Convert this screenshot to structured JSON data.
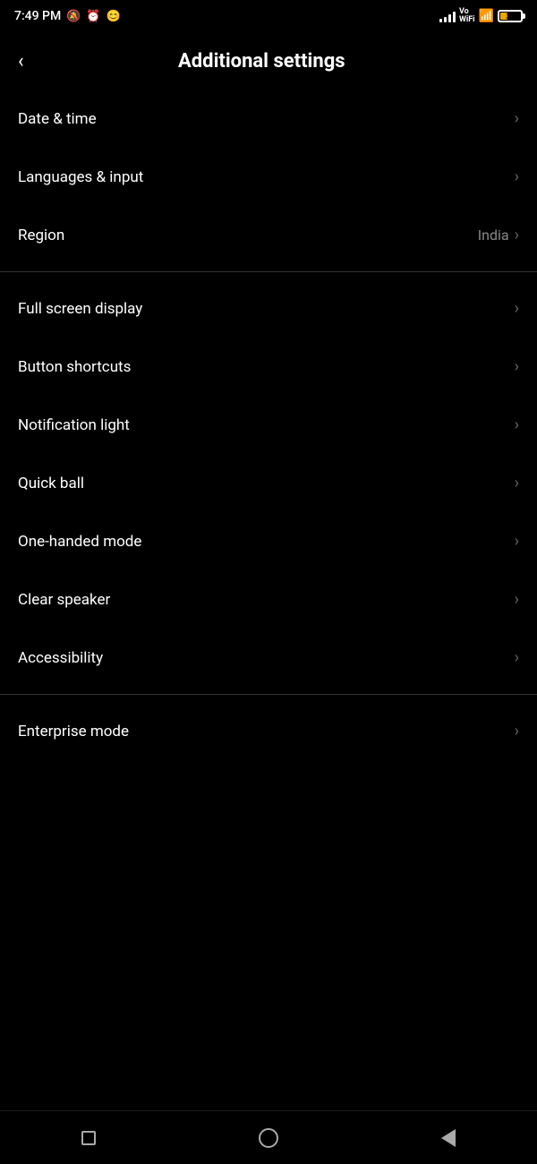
{
  "statusBar": {
    "time": "7:49 PM",
    "batteryLevel": 37,
    "batteryColor": "#f0a500"
  },
  "header": {
    "backLabel": "<",
    "title": "Additional settings"
  },
  "settingsGroups": [
    {
      "id": "group1",
      "items": [
        {
          "id": "date-time",
          "label": "Date & time",
          "value": "",
          "hasChevron": true
        },
        {
          "id": "languages-input",
          "label": "Languages & input",
          "value": "",
          "hasChevron": true
        },
        {
          "id": "region",
          "label": "Region",
          "value": "India",
          "hasChevron": true
        }
      ]
    },
    {
      "id": "group2",
      "items": [
        {
          "id": "full-screen-display",
          "label": "Full screen display",
          "value": "",
          "hasChevron": true
        },
        {
          "id": "button-shortcuts",
          "label": "Button shortcuts",
          "value": "",
          "hasChevron": true
        },
        {
          "id": "notification-light",
          "label": "Notification light",
          "value": "",
          "hasChevron": true
        },
        {
          "id": "quick-ball",
          "label": "Quick ball",
          "value": "",
          "hasChevron": true
        },
        {
          "id": "one-handed-mode",
          "label": "One-handed mode",
          "value": "",
          "hasChevron": true
        },
        {
          "id": "clear-speaker",
          "label": "Clear speaker",
          "value": "",
          "hasChevron": true
        },
        {
          "id": "accessibility",
          "label": "Accessibility",
          "value": "",
          "hasChevron": true
        }
      ]
    },
    {
      "id": "group3",
      "items": [
        {
          "id": "enterprise-mode",
          "label": "Enterprise mode",
          "value": "",
          "hasChevron": true
        }
      ]
    }
  ],
  "navBar": {
    "recentLabel": "recent",
    "homeLabel": "home",
    "backLabel": "back"
  }
}
